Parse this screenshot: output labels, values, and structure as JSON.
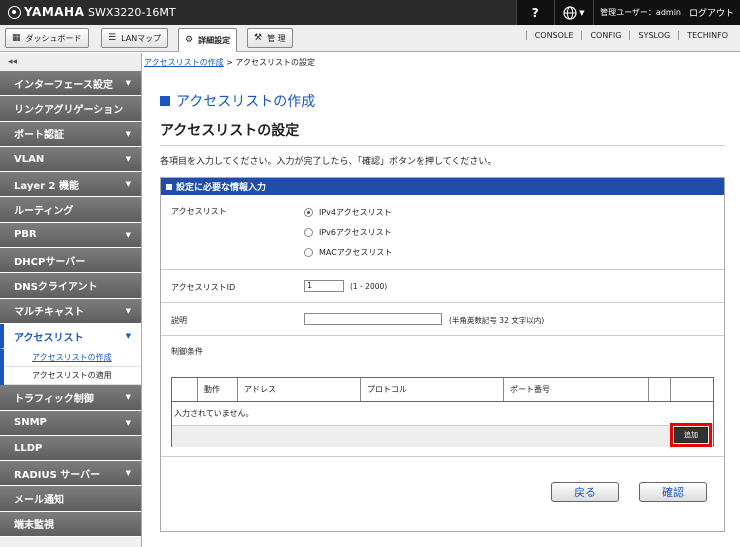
{
  "header": {
    "brand": "YAMAHA",
    "model": "SWX3220-16MT",
    "help": "?",
    "globe": "▽",
    "user_label": "管理ユーザー：admin",
    "logout": "ログアウト"
  },
  "tabs": [
    {
      "label": "ダッシュボード",
      "icon": "▦"
    },
    {
      "label": "LANマップ",
      "icon": "☰"
    },
    {
      "label": "詳細設定",
      "icon": "⚙"
    },
    {
      "label": "管 理",
      "icon": "⚒"
    }
  ],
  "toplinks": [
    "CONSOLE",
    "CONFIG",
    "SYSLOG",
    "TECHINFO"
  ],
  "sidebar": {
    "collapse": "◂◂",
    "items": [
      {
        "label": "インターフェース設定",
        "arrow": "▼"
      },
      {
        "label": "リンクアグリゲーション",
        "arrow": ""
      },
      {
        "label": "ポート認証",
        "arrow": "▼"
      },
      {
        "label": "VLAN",
        "arrow": "▼"
      },
      {
        "label": "Layer 2 機能",
        "arrow": "▼"
      },
      {
        "label": "ルーティング",
        "arrow": ""
      },
      {
        "label": "PBR",
        "arrow": "▼"
      },
      {
        "label": "DHCPサーバー",
        "arrow": ""
      },
      {
        "label": "DNSクライアント",
        "arrow": ""
      },
      {
        "label": "マルチキャスト",
        "arrow": "▼"
      },
      {
        "label": "アクセスリスト",
        "arrow": "▼"
      },
      {
        "label": "トラフィック制御",
        "arrow": "▼"
      },
      {
        "label": "SNMP",
        "arrow": "▼"
      },
      {
        "label": "LLDP",
        "arrow": ""
      },
      {
        "label": "RADIUS サーバー",
        "arrow": "▼"
      },
      {
        "label": "メール通知",
        "arrow": ""
      },
      {
        "label": "端末監視",
        "arrow": ""
      }
    ],
    "subitems": [
      "アクセスリストの作成",
      "アクセスリストの適用"
    ]
  },
  "breadcrumb": {
    "link": "アクセスリストの作成",
    "sep": ">",
    "current": "アクセスリストの設定"
  },
  "page": {
    "title": "アクセスリストの作成",
    "section_title": "アクセスリストの設定",
    "instruction": "各項目を入力してください。入力が完了したら、「確認」ボタンを押してください。"
  },
  "panel": {
    "header": "設定に必要な情報入力",
    "acl_label": "アクセスリスト",
    "acl_options": [
      "IPv4アクセスリスト",
      "IPv6アクセスリスト",
      "MACアクセスリスト"
    ],
    "acl_selected": "IPv4アクセスリスト",
    "id_label": "アクセスリストID",
    "id_value": "1",
    "id_hint": "(1 - 2000)",
    "desc_label": "説明",
    "desc_value": "",
    "desc_hint": "(半角英数記号 32 文字以内)",
    "cond_label": "制御条件",
    "table_headers": [
      "",
      "動作",
      "アドレス",
      "プロトコル",
      "ポート番号",
      ""
    ],
    "empty_text": "入力されていません。",
    "add_button": "追加"
  },
  "buttons": {
    "back": "戻る",
    "confirm": "確認"
  }
}
